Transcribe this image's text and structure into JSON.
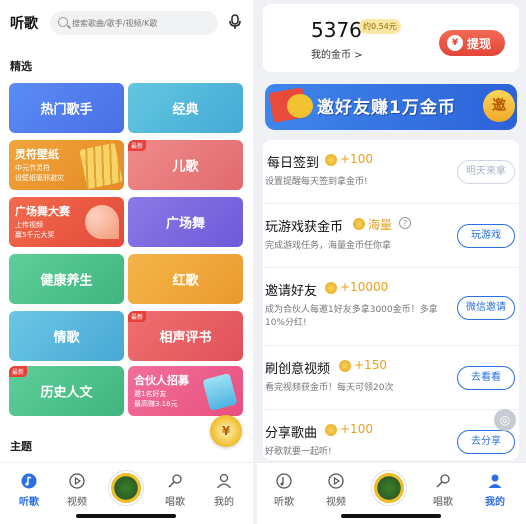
{
  "left": {
    "title": "听歌",
    "search_placeholder": "搜索歌曲/歌手/视频/K歌",
    "section_featured": "精选",
    "section_theme": "主题",
    "tiles": {
      "hot_singers": "热门歌手",
      "classic": "经典",
      "wallpaper_title": "灵符壁纸",
      "wallpaper_sub1": "中元节灵符",
      "wallpaper_sub2": "设壁纸驱邪避灾",
      "kids": "儿歌",
      "kids_badge": "最新",
      "square_contest_title": "广场舞大赛",
      "square_contest_sub1": "上传视频",
      "square_contest_sub2": "赢5千元大奖",
      "square_dance": "广场舞",
      "health": "健康养生",
      "red_songs": "红歌",
      "love_songs": "情歌",
      "crosstalk": "相声评书",
      "crosstalk_badge": "最新",
      "history": "历史人文",
      "history_badge": "最新",
      "partner_title": "合伙人招募",
      "partner_sub1": "邀1名好友",
      "partner_sub2": "最高赚3.18元"
    },
    "nav": [
      "听歌",
      "视频",
      "唱歌",
      "我的"
    ]
  },
  "right": {
    "coins": "5376",
    "coins_approx": "约0.54元",
    "coins_label": "我的金币 >",
    "withdraw": "提现",
    "banner_text": "邀好友赚1万金币",
    "banner_badge": "邀",
    "tasks": [
      {
        "name": "每日签到",
        "reward": "+100",
        "desc": "设置提醒每天签到拿金币!",
        "button": "明天来拿"
      },
      {
        "name": "玩游戏获金币",
        "reward": "海量",
        "desc": "完成游戏任务，海量金币任你拿",
        "button": "玩游戏"
      },
      {
        "name": "邀请好友",
        "reward": "+10000",
        "desc": "成为合伙人每邀1好友多拿3000金币！多拿10%分红!",
        "button": "微信邀请"
      },
      {
        "name": "刷创意视频",
        "reward": "+150",
        "desc": "看完视频获金币！每天可领20次",
        "button": "去看看"
      },
      {
        "name": "分享歌曲",
        "reward": "+100",
        "desc": "好歌就要一起听!",
        "button": "去分享"
      }
    ],
    "nav": [
      "听歌",
      "视频",
      "唱歌",
      "我的"
    ]
  },
  "colors": {
    "accent": "#2a6fe6",
    "coin": "#e8a21a",
    "withdraw": "#e2463a"
  }
}
